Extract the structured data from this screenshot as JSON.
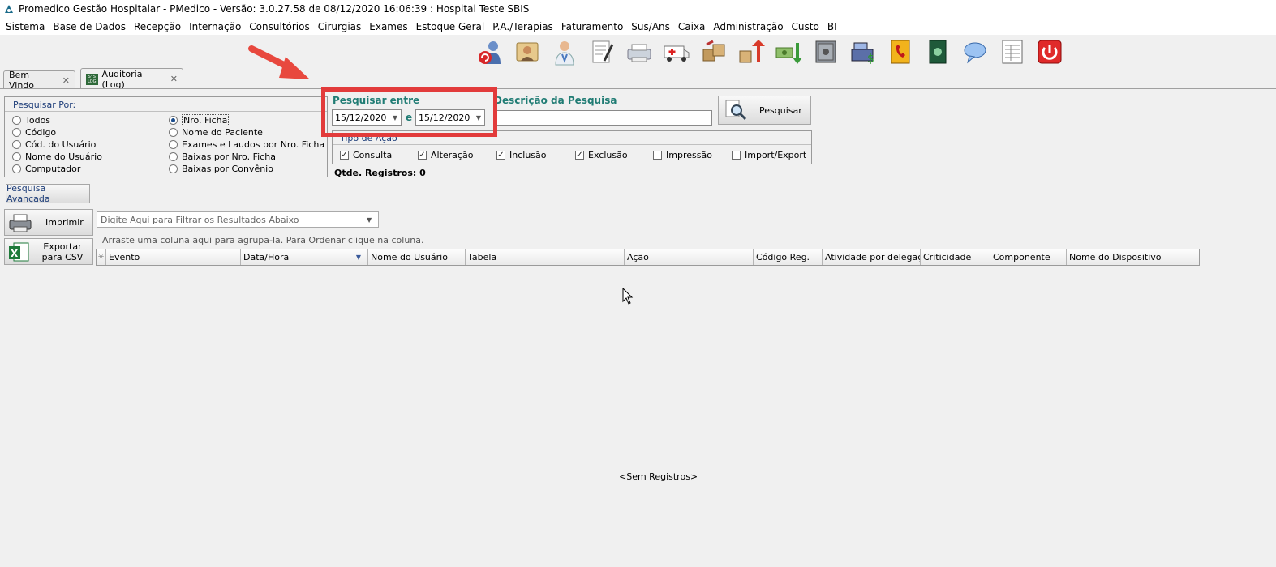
{
  "window": {
    "title": "Promedico Gestão Hospitalar - PMedico - Versão: 3.0.27.58 de 08/12/2020 16:06:39 : Hospital Teste SBIS"
  },
  "menu": [
    "Sistema",
    "Base de Dados",
    "Recepção",
    "Internação",
    "Consultórios",
    "Cirurgias",
    "Exames",
    "Estoque Geral",
    "P.A./Terapias",
    "Faturamento",
    "Sus/Ans",
    "Caixa",
    "Administração",
    "Custo",
    "BI"
  ],
  "toolbar_icons": [
    "refresh-users-icon",
    "reception-icon",
    "doctor-icon",
    "prescription-icon",
    "printer-bed-icon",
    "ambulance-icon",
    "stock-boxes-icon",
    "stock-up-icon",
    "money-icon",
    "safe-icon",
    "cash-register-icon",
    "phonebook-icon",
    "book-icon",
    "chat-icon",
    "report-icon",
    "power-icon"
  ],
  "tabs": [
    {
      "label": "Bem Vindo"
    },
    {
      "label": "Auditoria (Log)",
      "badge": "SYS LOG"
    }
  ],
  "search_by": {
    "title": "Pesquisar Por:",
    "options_left": [
      "Todos",
      "Código",
      "Cód. do Usuário",
      "Nome do Usuário",
      "Computador"
    ],
    "options_right": [
      "Nro. Ficha",
      "Nome do Paciente",
      "Exames e Laudos por Nro. Ficha",
      "Baixas por Nro. Ficha",
      "Baixas por Convênio"
    ],
    "selected": "Nro. Ficha"
  },
  "date_range": {
    "label": "Pesquisar entre",
    "from": "15/12/2020",
    "connector": "e",
    "to": "15/12/2020"
  },
  "description": {
    "label": "Descrição da Pesquisa",
    "value": ""
  },
  "search_button": {
    "label": "Pesquisar"
  },
  "action_type": {
    "title": "Tipo de Ação",
    "options": [
      {
        "label": "Consulta",
        "checked": true
      },
      {
        "label": "Alteração",
        "checked": true
      },
      {
        "label": "Inclusão",
        "checked": true
      },
      {
        "label": "Exclusão",
        "checked": true
      },
      {
        "label": "Impressão",
        "checked": false
      },
      {
        "label": "Import/Export",
        "checked": false
      }
    ]
  },
  "record_count": "Qtde. Registros: 0",
  "advanced_search_button": "Pesquisa Avançada",
  "print_button": "Imprimir",
  "export_button": "Exportar para CSV",
  "filter": {
    "placeholder": "Digite Aqui para Filtrar os Resultados Abaixo"
  },
  "group_hint": "Arraste uma coluna aqui para agrupa-la. Para Ordenar clique na coluna.",
  "grid": {
    "columns": [
      "Evento",
      "Data/Hora",
      "Nome do Usuário",
      "Tabela",
      "Ação",
      "Código Reg.",
      "Atividade por delegação",
      "Criticidade",
      "Componente",
      "Nome do Dispositivo"
    ],
    "sorted_column": "Data/Hora",
    "empty_text": "<Sem Registros>"
  },
  "colors": {
    "highlight": "#e23b3b",
    "arrow": "#e8483e",
    "teal_label": "#207c74",
    "group_title": "#1c3c78"
  }
}
